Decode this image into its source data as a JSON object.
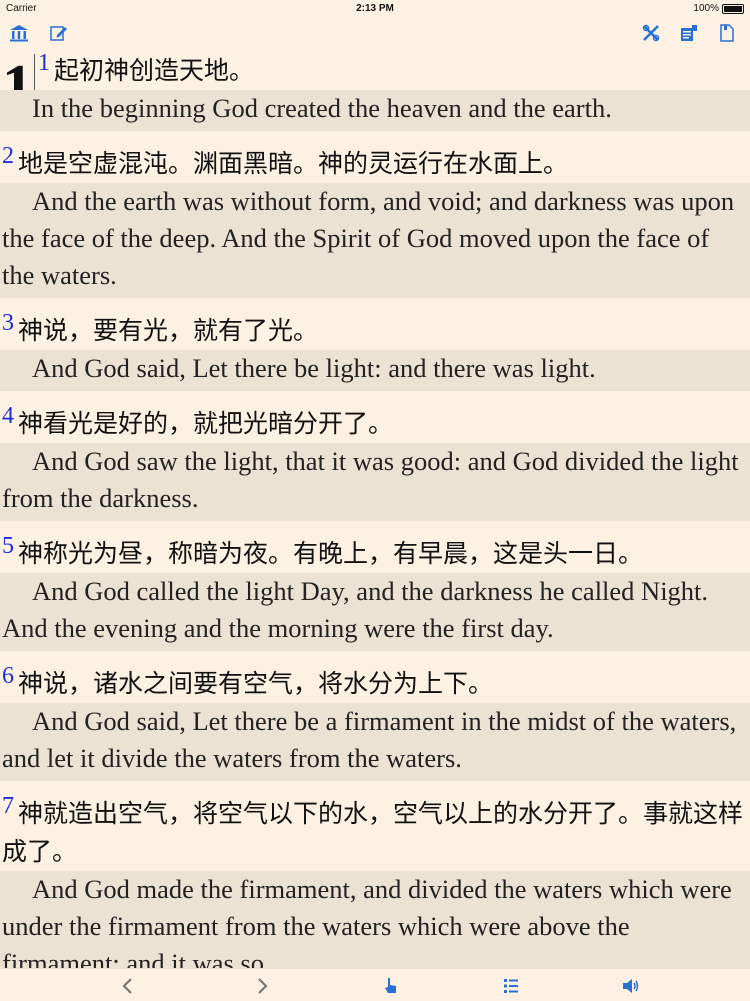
{
  "status_bar": {
    "carrier": "Carrier",
    "time": "2:13 PM",
    "battery": "100%"
  },
  "toolbar": {
    "left_icons": [
      "library-icon",
      "edit-icon"
    ],
    "right_icons": [
      "tools-icon",
      "reading-mode-icon",
      "bookmark-icon"
    ]
  },
  "chapter": "1",
  "verses": [
    {
      "num": "1",
      "cn": "起初神创造天地。",
      "en": "In the beginning God created the heaven and the earth."
    },
    {
      "num": "2",
      "cn": "地是空虚混沌。渊面黑暗。神的灵运行在水面上。",
      "en": "And the earth was without form, and void; and darkness was upon the face of the deep. And the Spirit of God moved upon the face of the waters."
    },
    {
      "num": "3",
      "cn": "神说，要有光，就有了光。",
      "en": "And God said, Let there be light: and there was light."
    },
    {
      "num": "4",
      "cn": "神看光是好的，就把光暗分开了。",
      "en": "And God saw the light, that it was good: and God divided the light from the darkness."
    },
    {
      "num": "5",
      "cn": "神称光为昼，称暗为夜。有晚上，有早晨，这是头一日。",
      "en": "And God called the light Day, and the darkness he called Night. And the evening and the morning were the first day."
    },
    {
      "num": "6",
      "cn": "神说，诸水之间要有空气，将水分为上下。",
      "en": "And God said, Let there be a firmament in the midst of the waters, and let it divide the waters from the waters."
    },
    {
      "num": "7",
      "cn": "神就造出空气，将空气以下的水，空气以上的水分开了。事就这样成了。",
      "en": "And God made the firmament, and divided the waters which were under the firmament from the waters which were above the firmament: and it was so."
    }
  ],
  "bottom_bar": {
    "icons": [
      "back-chevron-icon",
      "forward-chevron-icon",
      "tap-icon",
      "list-icon",
      "speaker-icon"
    ]
  },
  "colors": {
    "verse_number": "#1a2fd6",
    "icon": "#2a6fd6",
    "background": "#fcf1e2",
    "band": "#ece2d3"
  }
}
